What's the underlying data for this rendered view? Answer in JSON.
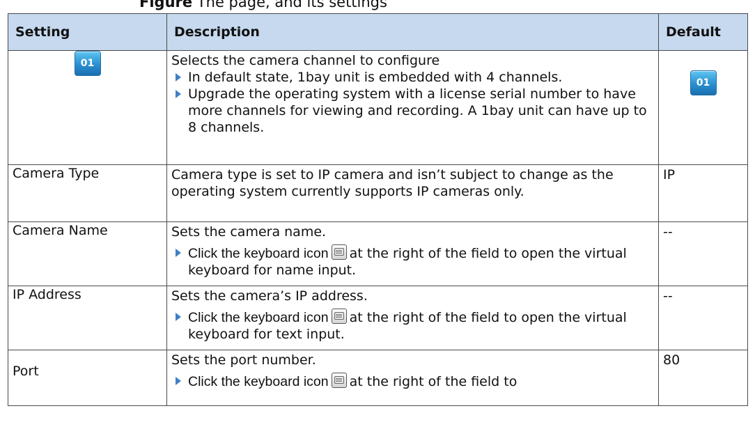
{
  "caption": {
    "prefix": "Figure",
    "text": "The page, and its settings"
  },
  "table": {
    "headers": {
      "setting": "Setting",
      "description": "Description",
      "default": "Default"
    },
    "rows": [
      {
        "setting_icon_text": "01",
        "description_lead": "Selects the camera channel to configure",
        "bullets": [
          "In default state, 1bay unit is embedded with 4 channels.",
          "Upgrade the operating system with a license serial number to have more channels for viewing and recording. A 1bay unit can have up to 8 channels."
        ],
        "default_icon_text": "01"
      },
      {
        "setting": "Camera Type",
        "description_lead": "Camera type is set to IP camera and isn’t subject to change as the operating system currently supports IP cameras only.",
        "default": "IP"
      },
      {
        "setting": "Camera Name",
        "description_lead": "Sets the camera name.",
        "bullet_pre": "Click the keyboard icon",
        "bullet_post": "at the right of the field to open the virtual keyboard for name input.",
        "default": "--"
      },
      {
        "setting": "IP Address",
        "description_lead": "Sets the camera’s IP address.",
        "bullet_pre": "Click the keyboard icon",
        "bullet_post": "at the right of the field to open the virtual keyboard for text input.",
        "default": "--"
      },
      {
        "setting": "Port",
        "description_lead": "Sets the port number.",
        "bullet_pre": "Click the keyboard icon",
        "bullet_post": "at the right of the field to",
        "default": "80"
      }
    ]
  },
  "icons": {
    "channel": "channel-01-icon",
    "keyboard": "keyboard-icon",
    "bullet": "triangle-bullet-icon"
  },
  "colors": {
    "header_bg": "#c6d9ef",
    "bullet": "#3f7fc6",
    "channel_icon": "#2a8fd0"
  }
}
